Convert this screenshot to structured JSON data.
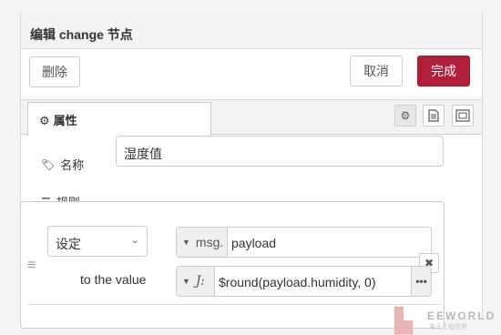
{
  "dialog": {
    "title": "编辑 change 节点"
  },
  "toolbar": {
    "delete_label": "删除",
    "cancel_label": "取消",
    "done_label": "完成"
  },
  "tabs": {
    "properties_label": "属性"
  },
  "form": {
    "name_label": "名称",
    "name_value": "湿度值",
    "rules_label": "规则",
    "rule": {
      "action": "设定",
      "target_type": "msg.",
      "target_value": "payload",
      "to_label": "to the value",
      "value_type": "J:",
      "value": "$round(payload.humidity, 0)"
    }
  },
  "watermark": {
    "brand": "EEWORLD",
    "subtitle": "电子工程世界"
  },
  "colors": {
    "done_button": "#b0203a"
  }
}
